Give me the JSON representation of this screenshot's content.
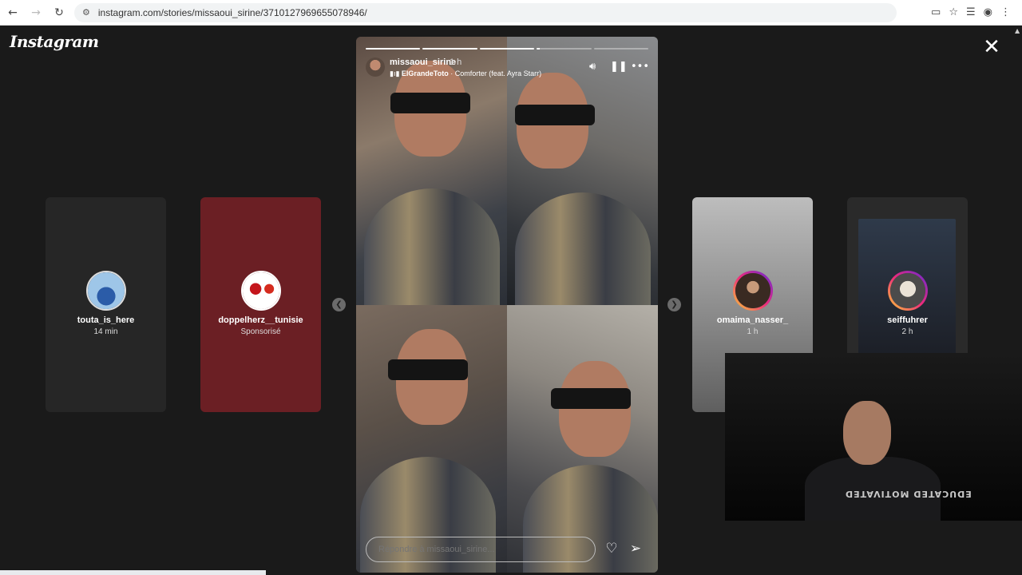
{
  "browser": {
    "url": "instagram.com/stories/missaoui_sirine/3710127969655078946/"
  },
  "page": {
    "logo": "Instagram"
  },
  "side_stories": [
    {
      "username": "touta_is_here",
      "sub": "14 min"
    },
    {
      "username": "doppelherz__tunisie",
      "sub": "Sponsorisé"
    },
    {
      "username": "omaima_nasser_",
      "sub": "1 h"
    },
    {
      "username": "seiffuhrer",
      "sub": "2 h"
    }
  ],
  "story": {
    "username": "missaoui_sirine",
    "time": "1 h",
    "music_artist": "ElGrandeToto",
    "music_title": "Comforter (feat. Ayra Starr)",
    "reply_placeholder": "Répondre à missaoui_sirine...",
    "progress": {
      "done": 3,
      "partial": 0.06,
      "total": 5
    }
  },
  "webcam": {
    "shirt_text": "EDUCATED MOTIVATED"
  }
}
